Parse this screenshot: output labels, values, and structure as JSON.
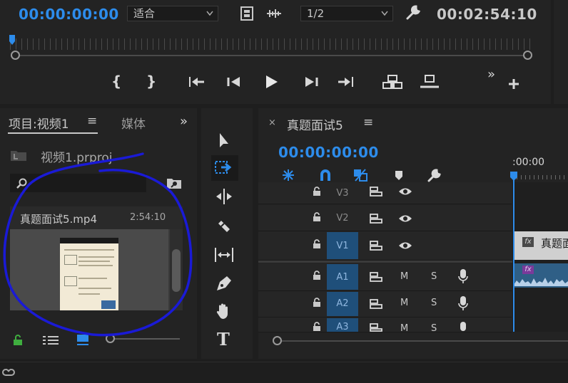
{
  "monitor": {
    "timecode_left": "00:00:00:00",
    "fit_value": "适合",
    "resolution_value": "1/2",
    "timecode_right": "00:02:54:10",
    "transport": {
      "mark_in": "{",
      "mark_out": "}",
      "more": "»"
    }
  },
  "project": {
    "tab_label": "项目:视频1",
    "tab_menu": "≡",
    "media_tab": "媒体",
    "overflow": "»",
    "file_name": "视频1.prproj",
    "search_placeholder": "",
    "clip_name": "真题面试5.mp4",
    "clip_duration": "2:54:10"
  },
  "timeline": {
    "close": "×",
    "sequence_name": "真题面试5",
    "menu": "≡",
    "timecode": "00:00:00:00",
    "ruler_label": ":00:00",
    "tracks": [
      {
        "name": "V3",
        "sync": "",
        "video": true
      },
      {
        "name": "V2",
        "sync": "",
        "video": true
      },
      {
        "name": "V1",
        "sync": "",
        "video": true
      },
      {
        "name": "A1",
        "m": "M",
        "s": "S"
      },
      {
        "name": "A2",
        "m": "M",
        "s": "S"
      },
      {
        "name": "A3",
        "m": "M",
        "s": "S"
      }
    ],
    "clip_fx": "fx",
    "clip_title": "真题面",
    "audio_fx": "fx"
  },
  "tools": {
    "type_label": "T"
  },
  "colors": {
    "accent_blue": "#2d8ceb",
    "annotation_blue": "#1a1ad6",
    "lock_green": "#3fae3f",
    "playhead": "#2d8ceb",
    "work_area": "#e8d800"
  }
}
